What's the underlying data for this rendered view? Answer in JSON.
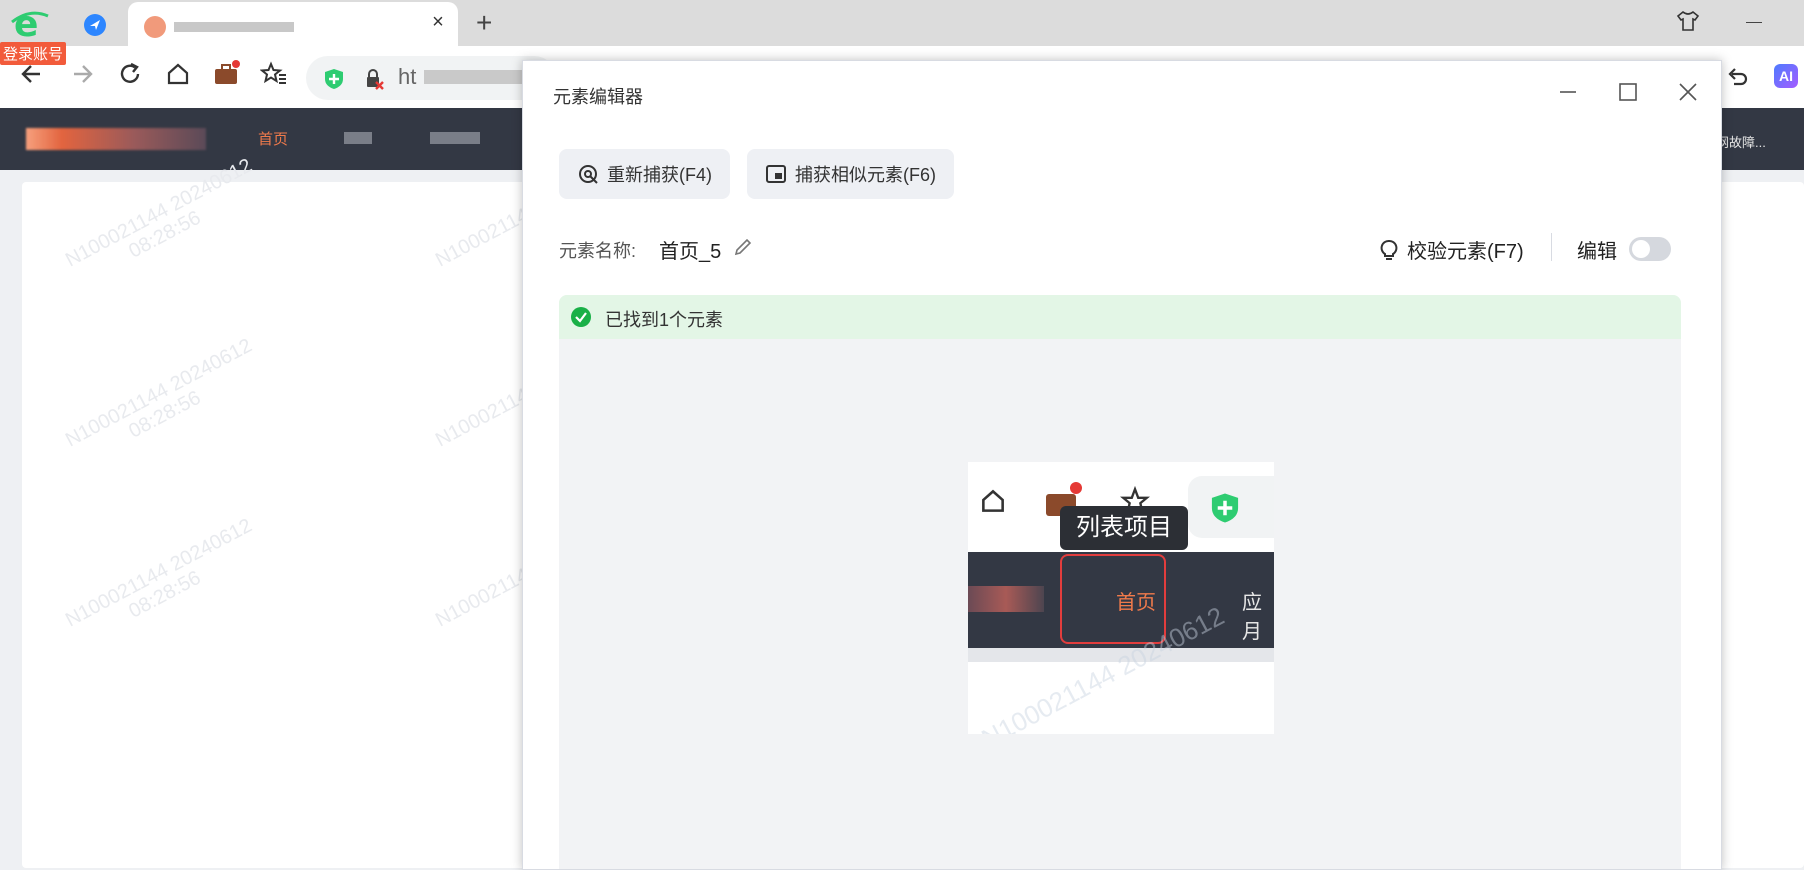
{
  "browser": {
    "login_badge": "登录账号",
    "url_partial": "ht",
    "ai_badge": "AI"
  },
  "site": {
    "nav_home": "首页",
    "right_text": "网故障..."
  },
  "watermark": {
    "line1": "N100021144 20240612",
    "line2": "08:28:56"
  },
  "dialog": {
    "title": "元素编辑器",
    "recapture_button": "重新捕获(F4)",
    "capture_similar_button": "捕获相似元素(F6)",
    "element_name_label": "元素名称:",
    "element_name_value": "首页_5",
    "verify_button": "校验元素(F7)",
    "edit_label": "编辑",
    "edit_toggle_on": false,
    "found_text": "已找到1个元素"
  },
  "preview": {
    "tooltip": "列表项目",
    "home": "首页",
    "app_partial": "应月"
  },
  "colors": {
    "accent_orange": "#f07a4b",
    "site_header": "#333844",
    "success_green": "#19b047",
    "highlight_red": "#e23d3d"
  }
}
